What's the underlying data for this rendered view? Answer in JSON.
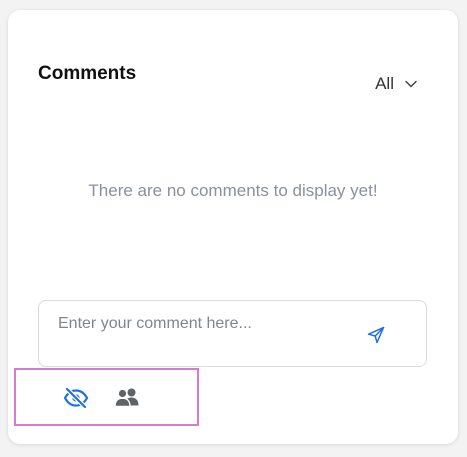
{
  "comments": {
    "title": "Comments",
    "filter": {
      "selected": "All"
    },
    "empty_message": "There are no comments to display yet!",
    "input": {
      "placeholder": "Enter your comment here...",
      "value": ""
    },
    "send_icon": "send-icon",
    "toolbar": {
      "items": [
        {
          "icon": "eye-off-icon",
          "state": "active",
          "color": "#1f6fe5"
        },
        {
          "icon": "users-icon",
          "state": "inactive",
          "color": "#5f6368"
        }
      ],
      "highlight_color": "#d67ad4"
    }
  },
  "colors": {
    "accent": "#1f6fe5",
    "muted_text": "#8a909c"
  }
}
